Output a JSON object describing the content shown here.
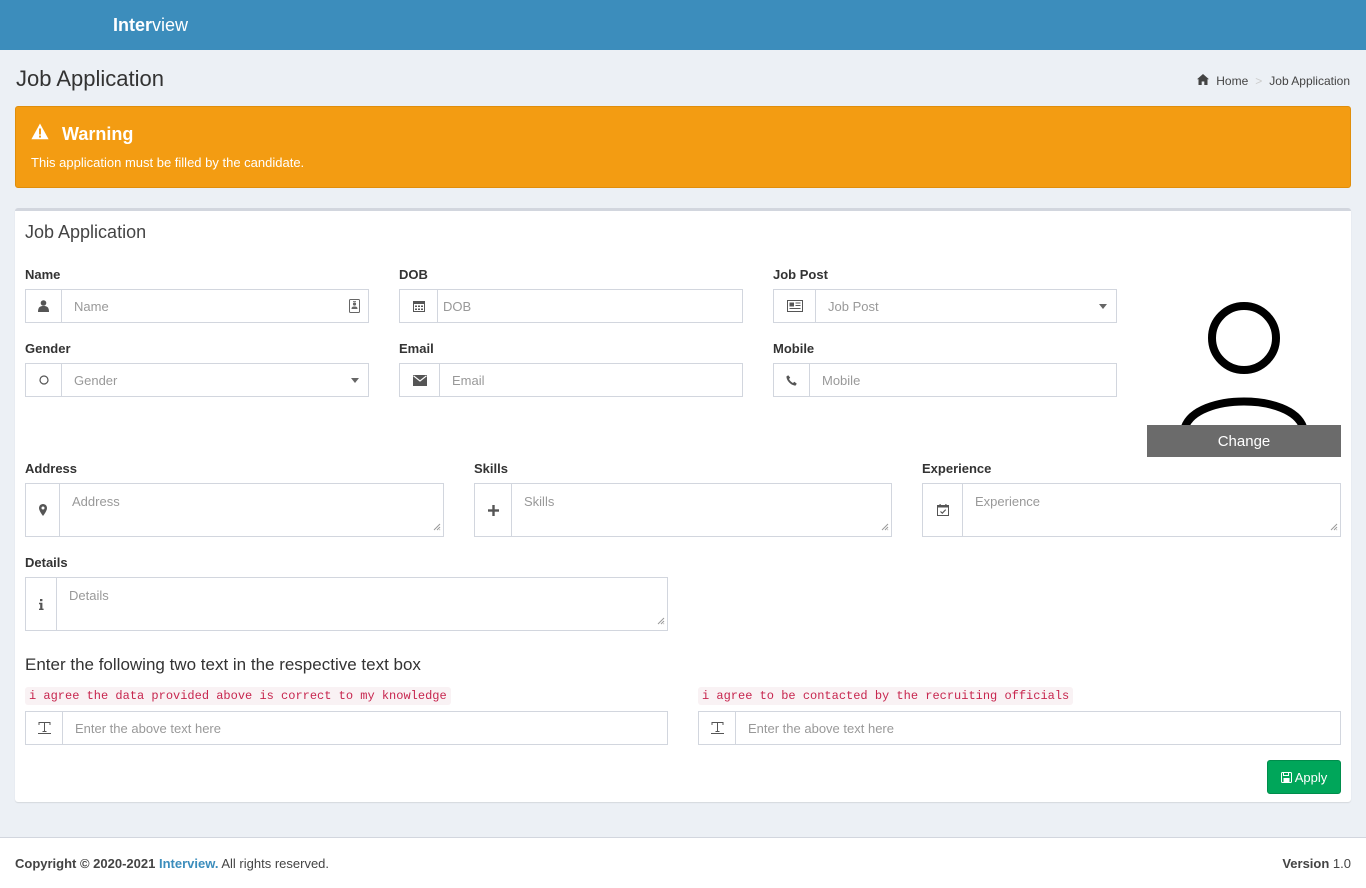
{
  "app": {
    "logo_bold": "Inter",
    "logo_light": "view"
  },
  "header": {
    "title": "Job Application"
  },
  "breadcrumb": {
    "items": [
      "Home",
      "Job Application"
    ]
  },
  "alert": {
    "title": "Warning",
    "text": "This application must be filled by the candidate.",
    "color": "#f39c12"
  },
  "form": {
    "title": "Job Application",
    "name": {
      "label": "Name",
      "placeholder": "Name",
      "icon": "user-icon"
    },
    "dob": {
      "label": "DOB",
      "placeholder": "DOB",
      "icon": "calendar-icon"
    },
    "job_post": {
      "label": "Job Post",
      "placeholder": "Job Post",
      "icon": "newspaper-icon"
    },
    "gender": {
      "label": "Gender",
      "placeholder": "Gender",
      "icon": "circle-icon"
    },
    "email": {
      "label": "Email",
      "placeholder": "Email",
      "icon": "envelope-icon"
    },
    "mobile": {
      "label": "Mobile",
      "placeholder": "Mobile",
      "icon": "phone-icon"
    },
    "address": {
      "label": "Address",
      "placeholder": "Address",
      "icon": "map-marker-icon"
    },
    "skills": {
      "label": "Skills",
      "placeholder": "Skills",
      "icon": "plus-icon"
    },
    "experience": {
      "label": "Experience",
      "placeholder": "Experience",
      "icon": "calendar-check-icon"
    },
    "details": {
      "label": "Details",
      "placeholder": "Details",
      "icon": "info-icon"
    },
    "photo": {
      "change_label": "Change"
    },
    "agreement": {
      "heading": "Enter the following two text in the respective text box",
      "text1": "i agree the data provided above is correct to my knowledge",
      "text2": "i agree to be contacted by the recruiting officials",
      "placeholder": "Enter the above text here"
    },
    "apply_label": "Apply"
  },
  "footer": {
    "copyright_prefix": "Copyright © 2020-2021",
    "brand": "Interview.",
    "rights": "All rights reserved.",
    "version_label": "Version",
    "version": "1.0"
  },
  "colors": {
    "header": "#3c8dbc",
    "warning": "#f39c12",
    "success": "#00a65a",
    "code": "#c7254e"
  }
}
